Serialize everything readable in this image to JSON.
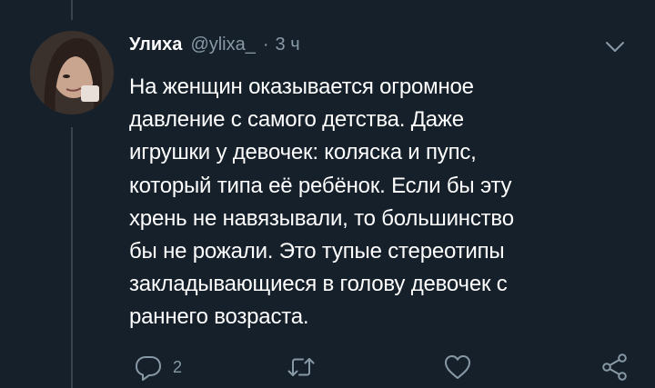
{
  "colors": {
    "background": "#15202b",
    "primary_text": "#ffffff",
    "secondary_text": "#8899a6",
    "thread_line": "#38444d"
  },
  "tweet": {
    "display_name": "Улиха",
    "handle": "@ylixa_",
    "separator": "·",
    "timestamp": "3 ч",
    "text_lines": [
      "На женщин оказывается огромное",
      "давление с самого детства. Даже",
      "игрушки у девочек: коляска и пупс,",
      "который типа её ребёнок. Если бы эту",
      "хрень не навязывали, то большинство",
      "бы не рожали. Это тупые стереотипы",
      "закладывающиеся в голову девочек с",
      "раннего возраста."
    ],
    "reply_count": "2"
  },
  "icons": {
    "menu": "chevron-down-icon",
    "reply": "reply-icon",
    "retweet": "retweet-icon",
    "like": "heart-icon",
    "share": "share-icon",
    "avatar": "avatar"
  }
}
